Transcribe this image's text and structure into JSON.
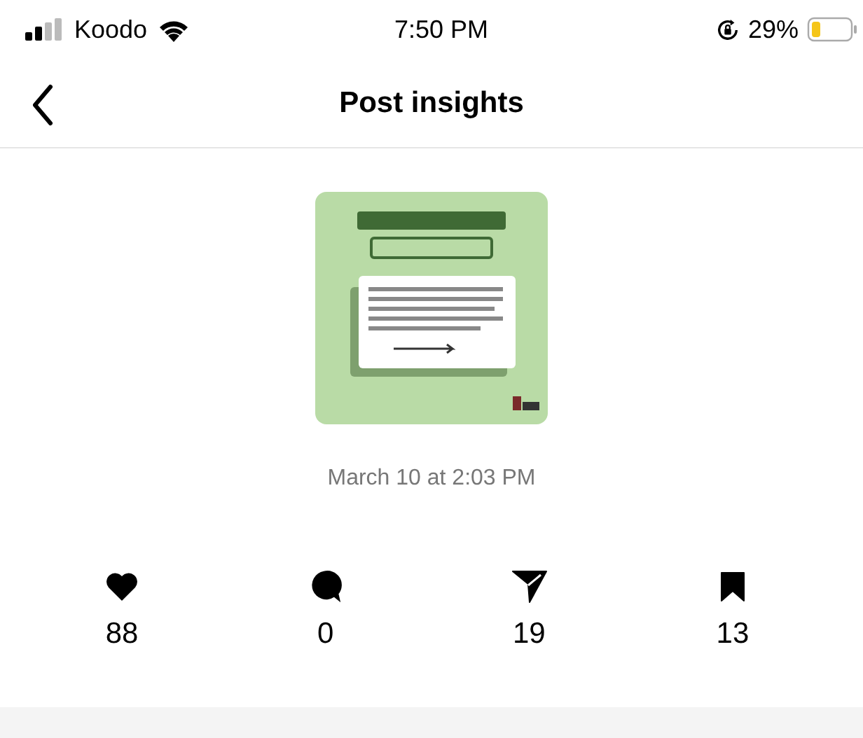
{
  "status_bar": {
    "carrier": "Koodo",
    "time": "7:50 PM",
    "battery": "29%"
  },
  "header": {
    "title": "Post insights"
  },
  "post": {
    "date": "March 10 at 2:03 PM"
  },
  "stats": [
    {
      "kind": "like",
      "count": "88"
    },
    {
      "kind": "comment",
      "count": "0"
    },
    {
      "kind": "share",
      "count": "19"
    },
    {
      "kind": "save",
      "count": "13"
    }
  ]
}
